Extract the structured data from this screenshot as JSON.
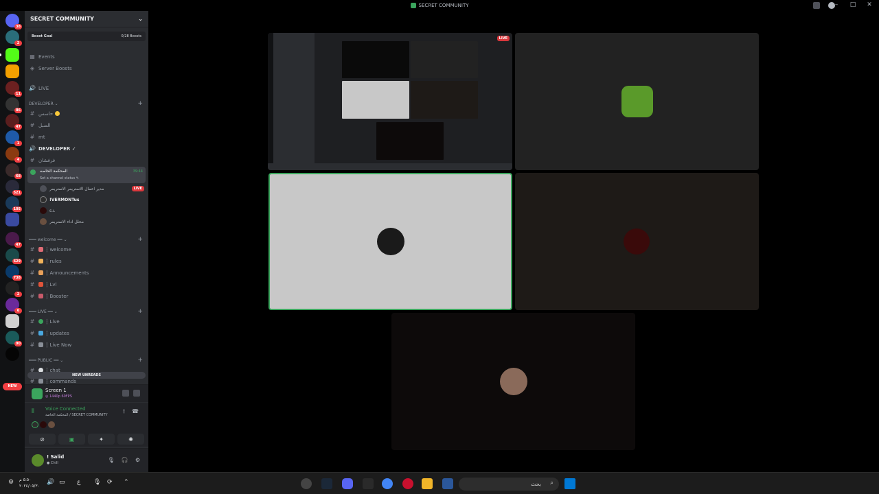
{
  "window": {
    "title": "SECRET COMMUNITY"
  },
  "server_rail": {
    "badges": [
      "38",
      "2",
      "11",
      "86",
      "47",
      "1",
      "4",
      "68",
      "521",
      "105",
      "47",
      "629",
      "738",
      "2",
      "6",
      "90"
    ],
    "new_label": "NEW"
  },
  "guild": {
    "name": "SECRET COMMUNITY",
    "boost_goal_label": "Boost Goal",
    "boost_count": "0/28 Boosts",
    "events_label": "Events",
    "server_boosts_label": "Server Boosts",
    "live_label": "LIVE"
  },
  "categories": {
    "developer": "DEVELOPER",
    "welcome": "welcome",
    "live": "LIVE",
    "public": "PUBLIC"
  },
  "channels": {
    "dev": [
      "حاسس",
      "الصبل",
      "mt",
      "DEVELOPER ✓",
      "فرفشان"
    ],
    "welcome": [
      "┆ welcome",
      "┆ rules",
      "┆ Announcements",
      "┆ Lvl",
      "┆ Booster"
    ],
    "live": [
      "┆ Live",
      "┆ updates",
      "┆ Live Now"
    ],
    "public": [
      "┆ chat",
      "┆ commands"
    ]
  },
  "voice_channel": {
    "name": "المحكمة الخاصه",
    "status": "Set a channel status ✎",
    "time": "39:44",
    "users": [
      "مدير اعمال الاستريمر الاستريمر",
      "!VERMONTus",
      "ꜱ.ʟ",
      "محلل اداء الاستريمر"
    ],
    "live_tag": "LIVE"
  },
  "new_unreads": "NEW UNREADS",
  "screen_share": {
    "title": "Screen 1",
    "quality": "◎ 1440p 60FPS"
  },
  "voice_connection": {
    "title": "Voice Connected",
    "subtitle": "المحكمة الخاصة / SECRET COMMUNITY"
  },
  "user": {
    "name": "! Salid",
    "status": "● Chill"
  },
  "stage": {
    "live_badge": "LIVE"
  },
  "taskbar": {
    "search_placeholder": "بحث",
    "clock_time": "٥:٥٠ م",
    "clock_date": "٢٠٢٤/٠٥/٣٠",
    "lang": "ع"
  },
  "colors": {
    "discord_green": "#3ba55d",
    "live_red": "#da373c",
    "sidebar": "#2b2d31",
    "rail": "#111214"
  }
}
